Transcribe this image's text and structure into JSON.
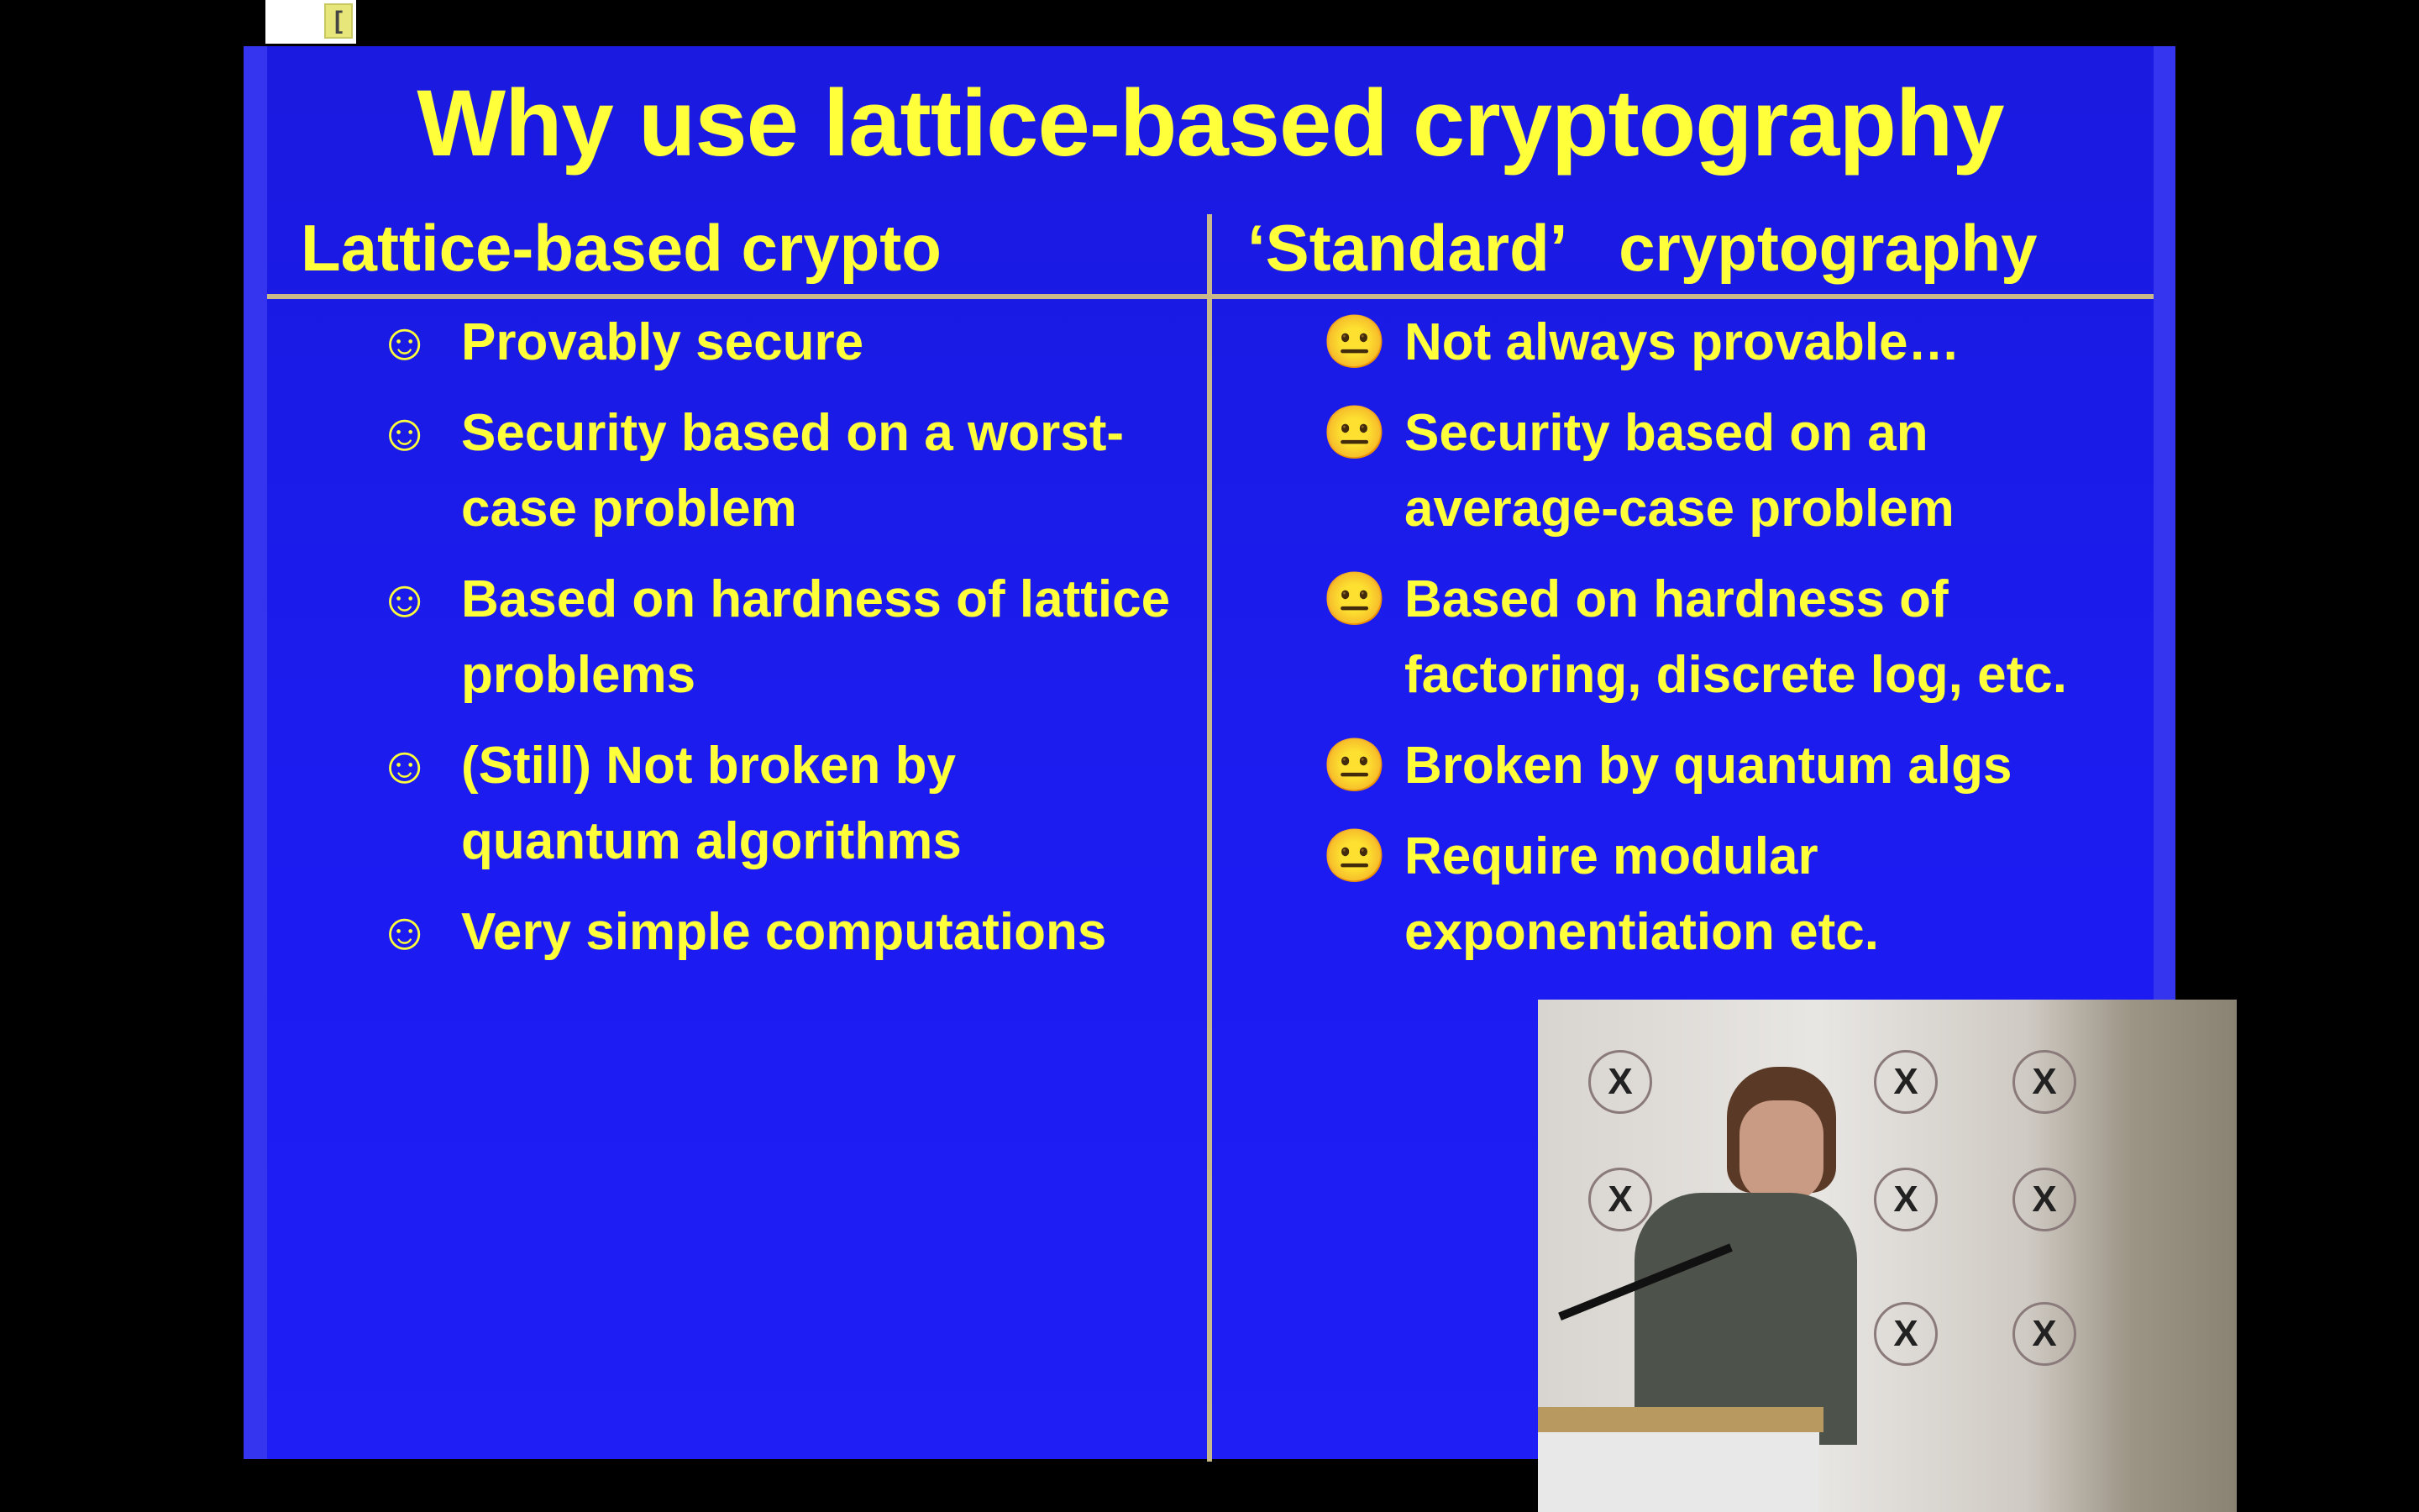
{
  "slide": {
    "title": "Why use lattice-based cryptography",
    "left_column": {
      "heading": "Lattice-based crypto",
      "icon": "smiley-face-icon",
      "items": [
        [
          "Provably secure"
        ],
        [
          "Security based on a worst-",
          "case problem"
        ],
        [
          "Based on hardness of lattice",
          "problems"
        ],
        [
          "(Still) Not broken by",
          "quantum algorithms"
        ],
        [
          "Very simple computations"
        ]
      ]
    },
    "right_column": {
      "heading": "‘Standard’   cryptography",
      "icon": "neutral-face-icon",
      "items": [
        [
          "Not always provable…"
        ],
        [
          "Security based on an",
          "average-case problem"
        ],
        [
          "Based on hardness of",
          "factoring, discrete log, etc."
        ],
        [
          "Broken by quantum algs"
        ],
        [
          "Require modular",
          "exponentiation etc."
        ]
      ]
    },
    "colors": {
      "background": "#1c1cf0",
      "text": "#ffff3a",
      "rule": "#c9b98a"
    }
  },
  "video_inset": {
    "description_icon": "speaker-video-icon"
  }
}
